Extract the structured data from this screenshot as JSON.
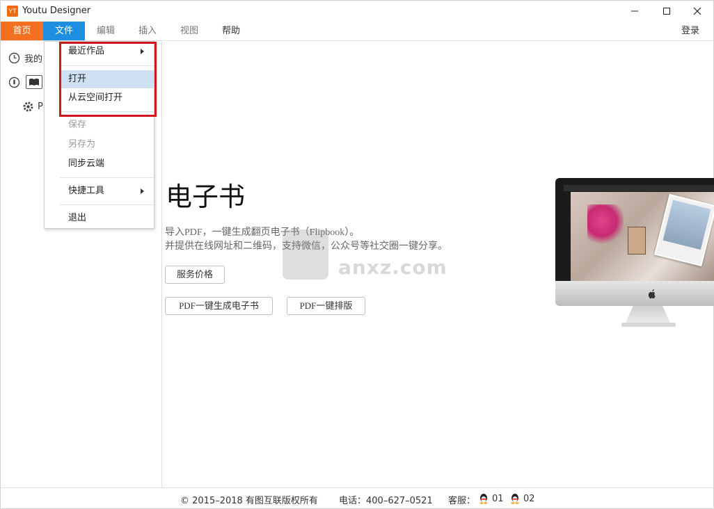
{
  "window": {
    "title": "Youtu Designer",
    "logo_text": "YT"
  },
  "menubar": {
    "home": "首页",
    "file": "文件",
    "edit": "编辑",
    "insert": "插入",
    "view": "视图",
    "help": "帮助",
    "login": "登录"
  },
  "sidebar": {
    "recent_label": "我的",
    "settings_label": "P"
  },
  "file_menu": {
    "items": [
      {
        "label": "最近作品",
        "submenu": true,
        "enabled": true
      },
      {
        "label": "打开",
        "enabled": true,
        "active": true
      },
      {
        "label": "从云空间打开",
        "enabled": true
      },
      {
        "label": "保存",
        "enabled": false
      },
      {
        "label": "另存为",
        "enabled": false
      },
      {
        "label": "同步云端",
        "enabled": true
      },
      {
        "label": "快捷工具",
        "submenu": true,
        "enabled": true
      },
      {
        "label": "退出",
        "enabled": true
      }
    ]
  },
  "main": {
    "headline": "电子书",
    "desc_line1": "导入PDF，一键生成翻页电子书（Flipbook）。",
    "desc_line2": "并提供在线网址和二维码，支持微信，公众号等社交圈一键分享。",
    "btn_price": "服务价格",
    "btn_pdf_ebook": "PDF一键生成电子书",
    "btn_pdf_layout": "PDF一键排版"
  },
  "watermark": {
    "text": "anxz.com"
  },
  "footer": {
    "copyright": "© 2015–2018 有图互联版权所有",
    "phone": "电话：400–627–0521",
    "service_label": "客服：",
    "qq1": "01",
    "qq2": "02"
  },
  "colors": {
    "home_tab": "#f37021",
    "file_tab": "#1e8fe0",
    "highlight_border": "#d0161d",
    "menu_active_bg": "#cfe0f2"
  }
}
